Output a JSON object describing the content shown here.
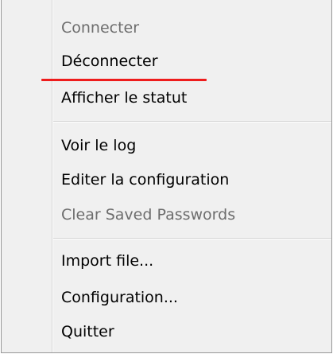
{
  "menu": {
    "items": [
      {
        "label": "Connecter",
        "enabled": false
      },
      {
        "label": "Déconnecter",
        "enabled": true
      },
      {
        "label": "Afficher le statut",
        "enabled": true
      },
      {
        "label": "Voir le log",
        "enabled": true
      },
      {
        "label": "Editer la configuration",
        "enabled": true
      },
      {
        "label": "Clear Saved Passwords",
        "enabled": false
      },
      {
        "label": "Import file...",
        "enabled": true
      },
      {
        "label": "Configuration...",
        "enabled": true
      },
      {
        "label": "Quitter",
        "enabled": true
      }
    ]
  },
  "colors": {
    "menu_background": "#f0f0f0",
    "disabled_text": "#6d6d6d",
    "annotation_underline": "#ee1c1c"
  }
}
